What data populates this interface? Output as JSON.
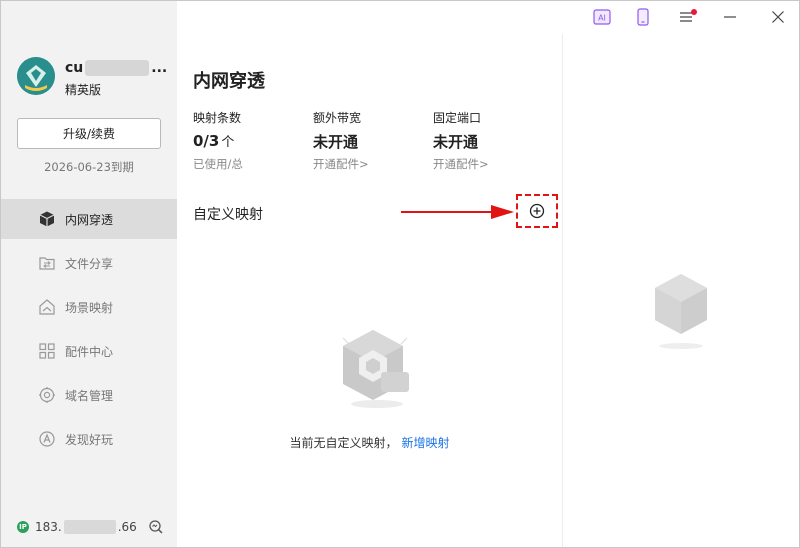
{
  "sidebar": {
    "username_prefix": "cu",
    "username_suffix": "...",
    "edition": "精英版",
    "upgrade_label": "升级/续费",
    "expiry": "2026-06-23到期",
    "nav": [
      {
        "label": "内网穿透",
        "icon": "cube-icon",
        "active": true
      },
      {
        "label": "文件分享",
        "icon": "file-share-icon",
        "active": false
      },
      {
        "label": "场景映射",
        "icon": "scene-map-icon",
        "active": false
      },
      {
        "label": "配件中心",
        "icon": "accessories-icon",
        "active": false
      },
      {
        "label": "域名管理",
        "icon": "domain-icon",
        "active": false
      },
      {
        "label": "发现好玩",
        "icon": "discover-icon",
        "active": false
      }
    ],
    "ip_badge": "IP",
    "ip_prefix": "183.",
    "ip_suffix": ".66"
  },
  "titlebar": {
    "ai_label": "AI"
  },
  "main": {
    "title": "内网穿透",
    "stats": [
      {
        "label": "映射条数",
        "value": "0/3",
        "unit": "个",
        "sub": "已使用/总"
      },
      {
        "label": "额外带宽",
        "value": "未开通",
        "unit": "",
        "sub": "开通配件>"
      },
      {
        "label": "固定端口",
        "value": "未开通",
        "unit": "",
        "sub": "开通配件>"
      }
    ],
    "section_title": "自定义映射",
    "empty_text": "当前无自定义映射，",
    "empty_link": "新增映射"
  },
  "colors": {
    "accent": "#1a73e8",
    "annotation_red": "#e01414",
    "logo_teal": "#2a8f8c",
    "ip_green": "#2aa05c",
    "notification_dot": "#e8193c"
  }
}
